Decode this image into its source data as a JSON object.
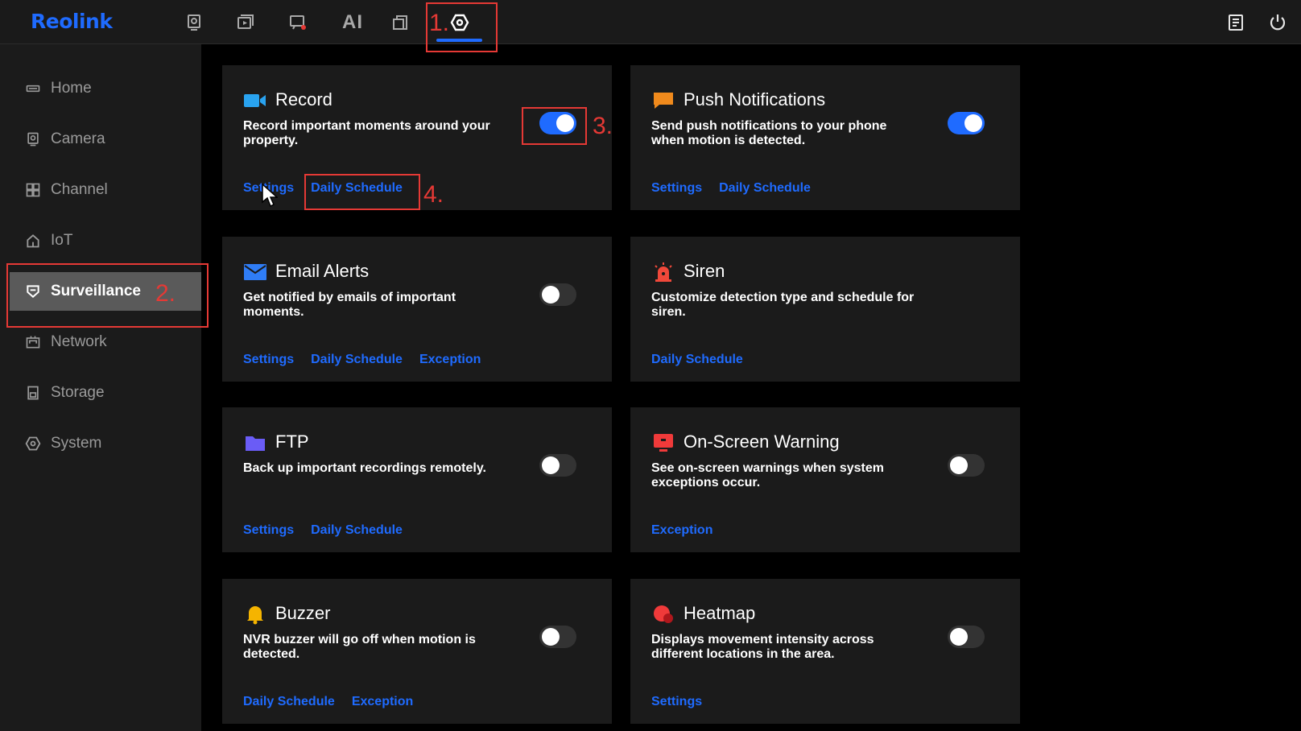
{
  "app": {
    "logo": "Reolink",
    "top_nav": {
      "ai_label": "AI",
      "icons": [
        "monitor-icon",
        "playback-icon",
        "alert-icon",
        "ai-text",
        "tablet-icon",
        "settings-icon",
        "notes-icon",
        "power-icon"
      ]
    }
  },
  "sidebar": {
    "items": [
      {
        "label": "Home",
        "icon": "home-display-icon"
      },
      {
        "label": "Camera",
        "icon": "camera-icon"
      },
      {
        "label": "Channel",
        "icon": "grid-icon"
      },
      {
        "label": "IoT",
        "icon": "house-icon"
      },
      {
        "label": "Surveillance",
        "icon": "shield-icon",
        "active": true
      },
      {
        "label": "Network",
        "icon": "network-icon"
      },
      {
        "label": "Storage",
        "icon": "storage-icon"
      },
      {
        "label": "System",
        "icon": "gear-icon"
      }
    ]
  },
  "cards": {
    "record": {
      "title": "Record",
      "desc": "Record important moments around your property.",
      "toggle_on": true,
      "links": [
        "Settings",
        "Daily Schedule"
      ],
      "icon_color": "#29a3f0"
    },
    "push": {
      "title": "Push Notifications",
      "desc": "Send push notifications to your phone when motion is detected.",
      "toggle_on": true,
      "links": [
        "Settings",
        "Daily Schedule"
      ],
      "icon_color": "#f08a1c"
    },
    "email": {
      "title": "Email Alerts",
      "desc": "Get notified by emails of important moments.",
      "toggle_on": false,
      "links": [
        "Settings",
        "Daily Schedule",
        "Exception"
      ],
      "icon_color": "#2f7df6"
    },
    "siren": {
      "title": "Siren",
      "desc": "Customize detection type and schedule for siren.",
      "links": [
        "Daily Schedule"
      ],
      "icon_color": "#f0483a"
    },
    "ftp": {
      "title": "FTP",
      "desc": "Back up important recordings remotely.",
      "toggle_on": false,
      "links": [
        "Settings",
        "Daily Schedule"
      ],
      "icon_color": "#6a5cf6"
    },
    "onscreen": {
      "title": "On-Screen Warning",
      "desc": "See on-screen warnings when system exceptions occur.",
      "toggle_on": false,
      "links": [
        "Exception"
      ],
      "icon_color": "#f03a3a"
    },
    "buzzer": {
      "title": "Buzzer",
      "desc": "NVR buzzer will go off when motion is detected.",
      "toggle_on": false,
      "links": [
        "Daily Schedule",
        "Exception"
      ],
      "icon_color": "#f5b400"
    },
    "heatmap": {
      "title": "Heatmap",
      "desc": "Displays movement intensity across different locations in the area.",
      "toggle_on": false,
      "links": [
        "Settings"
      ],
      "icon_color": "#f03a3a"
    }
  },
  "annotations": {
    "a1": "1.",
    "a2": "2.",
    "a3": "3.",
    "a4": "4."
  },
  "colors": {
    "accent": "#1f6bff",
    "annotation": "#e53935",
    "background": "#000000",
    "panel": "#1b1b1b"
  }
}
